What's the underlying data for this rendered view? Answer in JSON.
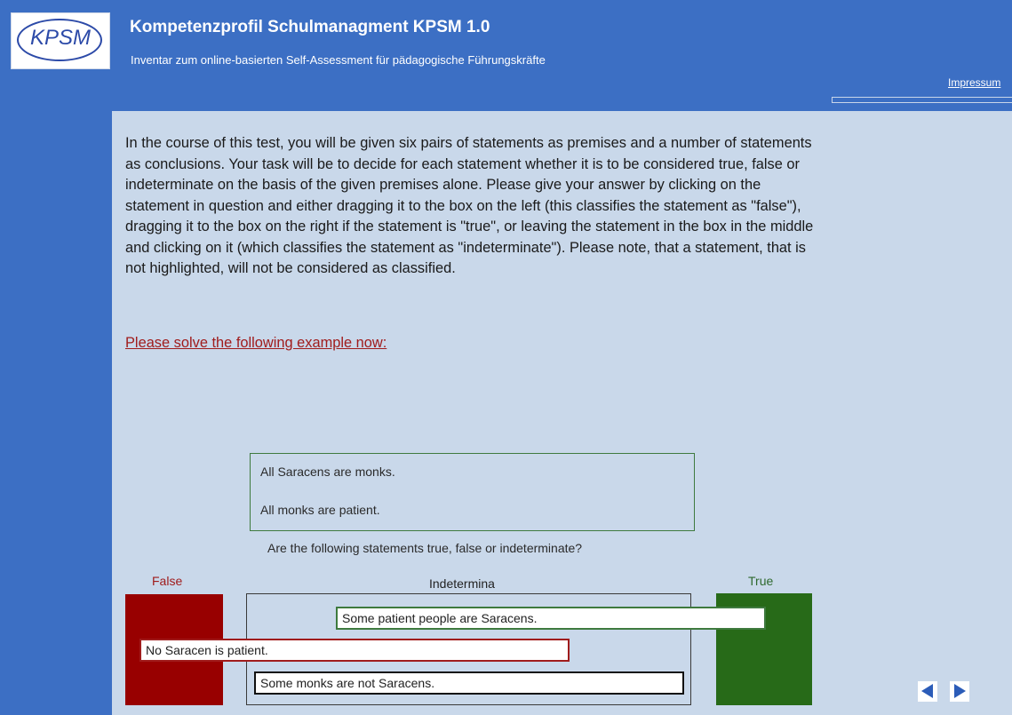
{
  "header": {
    "logo_text": "KPSM",
    "title": "Kompetenzprofil Schulmanagment KPSM 1.0",
    "subtitle": "Inventar zum online-basierten Self-Assessment für pädagogische Führungskräfte",
    "imprint_link": "Impressum"
  },
  "main": {
    "instructions": "In the course of this test, you will be given six pairs of statements as premises and a number of statements as conclusions. Your task will be to decide for each statement whether it is to be considered true, false or indeterminate on the basis of the given premises alone. Please give your answer by clicking on the statement in question and either dragging it to the box on the left (this classifies the statement as \"false\"), dragging it to the box on the right if the statement is \"true\", or leaving the statement in the box in the middle and clicking on it (which classifies the statement as \"indeterminate\"). Please note, that a statement, that is not highlighted, will not be considered as classified.",
    "example_link": "Please solve the following example now:"
  },
  "task": {
    "premises": [
      "All Saracens are monks.",
      "All monks are patient."
    ],
    "question": "Are the following statements true, false or indeterminate?",
    "columns": {
      "false_label": "False",
      "indeterminate_label": "Indetermina",
      "true_label": "True"
    },
    "statements": [
      {
        "text": "Some patient people are Saracens.",
        "classification": "true",
        "border_color": "#3e7a3e"
      },
      {
        "text": "No Saracen is patient.",
        "classification": "false",
        "border_color": "#a01c1c"
      },
      {
        "text": "Some monks are not Saracens.",
        "classification": "indeterminate",
        "border_color": "#111111"
      }
    ]
  },
  "colors": {
    "frame_blue": "#3c6fc4",
    "content_bg": "#c9d8ea",
    "false_box": "#980000",
    "true_box": "#276a18",
    "link_red": "#a01c1c"
  },
  "navigation": {
    "prev_icon": "triangle-left-icon",
    "next_icon": "triangle-right-icon"
  }
}
